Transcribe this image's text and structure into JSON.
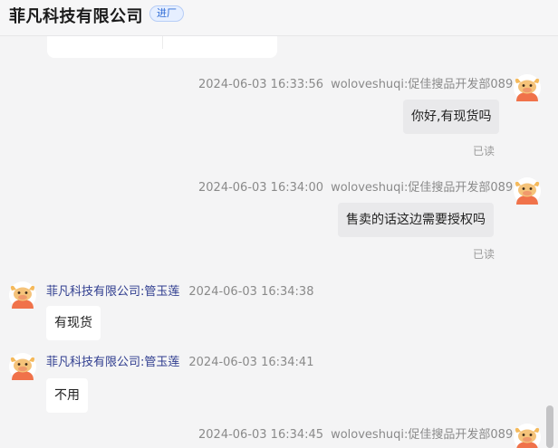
{
  "header": {
    "company_name": "菲凡科技有限公司",
    "tag": "进厂"
  },
  "messages": [
    {
      "side": "right",
      "time": "2024-06-03 16:33:56",
      "sender": "woloveshuqi:促佳搜品开发部089",
      "text": "你好,有现货吗",
      "status": "已读"
    },
    {
      "side": "right",
      "time": "2024-06-03 16:34:00",
      "sender": "woloveshuqi:促佳搜品开发部089",
      "text": "售卖的话这边需要授权吗",
      "status": "已读"
    },
    {
      "side": "left",
      "time": "2024-06-03 16:34:38",
      "sender": "菲凡科技有限公司:管玉莲",
      "text": "有现货"
    },
    {
      "side": "left",
      "time": "2024-06-03 16:34:41",
      "sender": "菲凡科技有限公司:管玉莲",
      "text": "不用"
    },
    {
      "side": "right",
      "time": "2024-06-03 16:34:45",
      "sender": "woloveshuqi:促佳搜品开发部089"
    }
  ],
  "colors": {
    "tag_text": "#2d6bd6",
    "left_sender": "#2f3d8f",
    "avatar_orange": "#f0724a",
    "avatar_skin": "#f5c37a"
  }
}
